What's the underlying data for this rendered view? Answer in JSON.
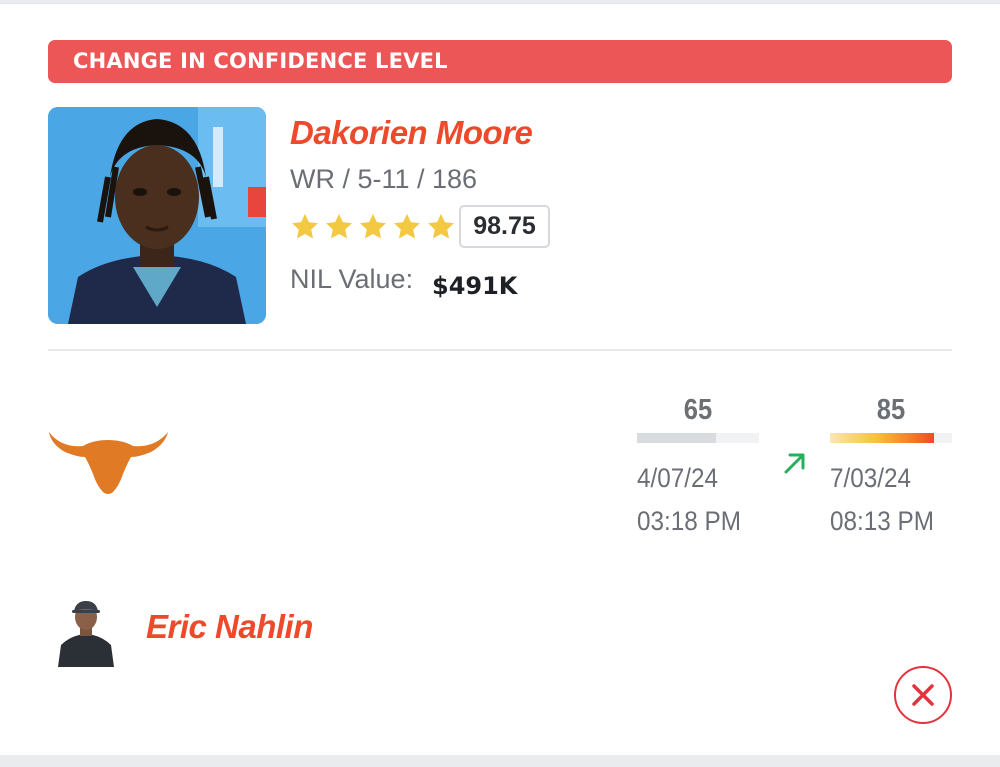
{
  "banner": {
    "title": "CHANGE IN CONFIDENCE LEVEL"
  },
  "player": {
    "name": "Dakorien Moore",
    "meta": "WR / 5-11 / 186",
    "stars": 5,
    "rating": "98.75",
    "nil_label": "NIL Value:",
    "nil_value": "$491K"
  },
  "prediction": {
    "previous": {
      "value": "65",
      "confidence": 0.65,
      "date": "4/07/24",
      "time": "03:18 PM"
    },
    "current": {
      "value": "85",
      "confidence": 0.85,
      "date": "7/03/24",
      "time": "08:13 PM"
    },
    "trend": "up"
  },
  "team": {
    "logo_icon": "longhorn-logo-icon",
    "color": "#e07a25"
  },
  "coach": {
    "name": "Eric Nahlin"
  },
  "colors": {
    "accent": "#ec4a2b",
    "banner": "#ec5656",
    "star": "#f3c843",
    "trend_up": "#22b35a",
    "close": "#e2343d"
  }
}
